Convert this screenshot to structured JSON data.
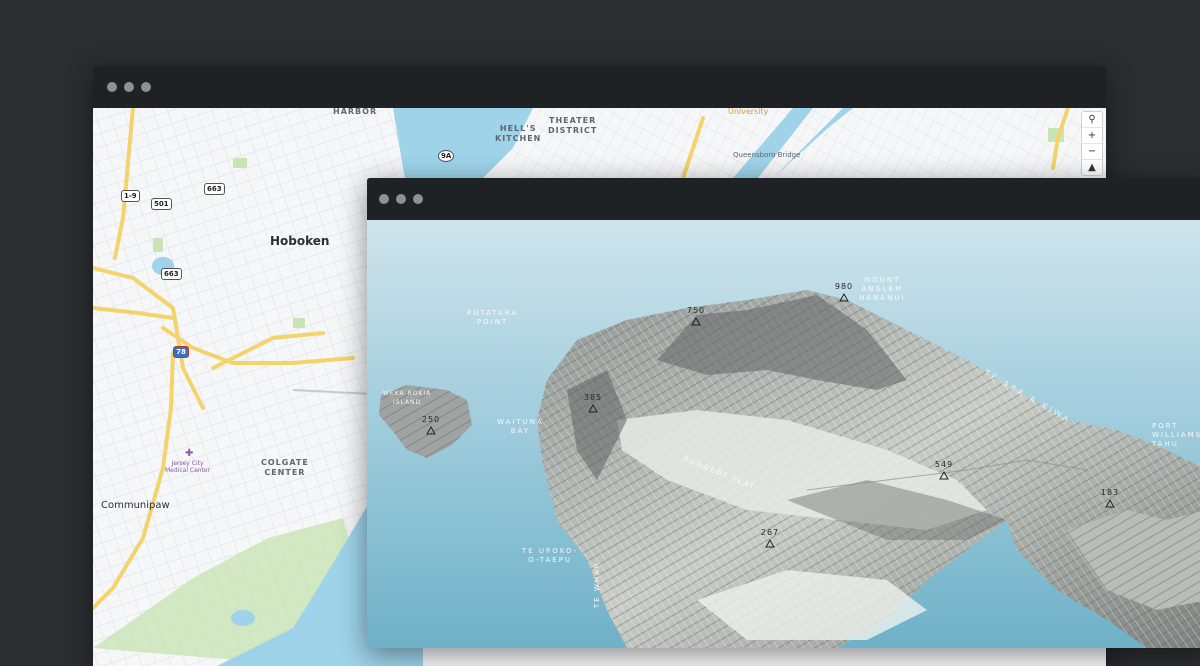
{
  "back_window": {
    "street_labels": [
      "HARBOR",
      "HELL'S\nKITCHEN",
      "THEATER\nDISTRICT",
      "University",
      "Queensboro Bridge",
      "COLGATE\nCENTER"
    ],
    "places": [
      "Hoboken",
      "Communipaw",
      "Jersey City\nMedical Center"
    ],
    "shields": [
      "1-9",
      "501",
      "663",
      "663",
      "9A",
      "78"
    ],
    "controls": [
      "search-icon",
      "+",
      "−",
      "compass-icon"
    ]
  },
  "front_window": {
    "water_labels": [
      "PUTATARA\nPOINT",
      "WAITUNA\nBAY",
      "TE UPOKO-\nO-TAEPU",
      "TE ARA A KIWA",
      "MOUNT\nANGLEM\nHANANUI",
      "WEKA ROKIA\nISLAND",
      "PORT\nWILLIAMS\nTAHU",
      "RUGGEDY FLAT",
      "TE WHAR"
    ],
    "peaks": [
      "980",
      "750",
      "385",
      "250",
      "549",
      "183",
      "267"
    ]
  },
  "colors": {
    "background": "#2b2e31",
    "titlebar": "#1f2225",
    "water_street_map": "#9ed3ea",
    "water_terrain": "#8ec4d7",
    "road_major": "#f3d36c"
  }
}
